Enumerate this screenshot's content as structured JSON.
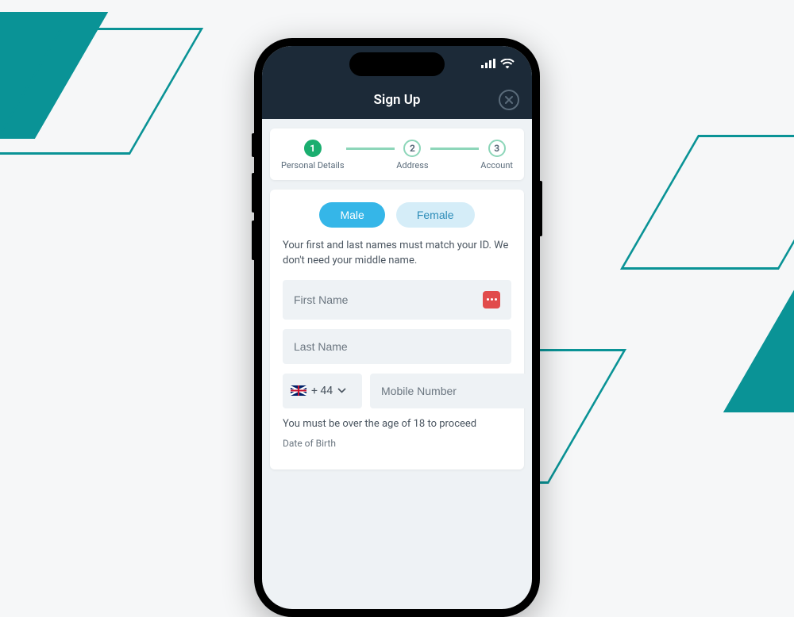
{
  "header": {
    "title": "Sign Up"
  },
  "stepper": {
    "steps": [
      {
        "num": "1",
        "label": "Personal Details",
        "active": true
      },
      {
        "num": "2",
        "label": "Address",
        "active": false
      },
      {
        "num": "3",
        "label": "Account",
        "active": false
      }
    ]
  },
  "form": {
    "gender_male": "Male",
    "gender_female": "Female",
    "name_note": "Your first and last names must match your ID. We don't need your middle name.",
    "first_name_placeholder": "First Name",
    "last_name_placeholder": "Last Name",
    "country_code": "+ 44",
    "mobile_placeholder": "Mobile Number",
    "age_note": "You must be over the age of 18 to proceed",
    "dob_label": "Date of Birth"
  },
  "colors": {
    "accent_teal": "#0a9396",
    "step_active": "#1aae6f",
    "pill_active": "#35b6e8",
    "pill_inactive_bg": "#d5edf8",
    "header_bg": "#1c2a38"
  }
}
